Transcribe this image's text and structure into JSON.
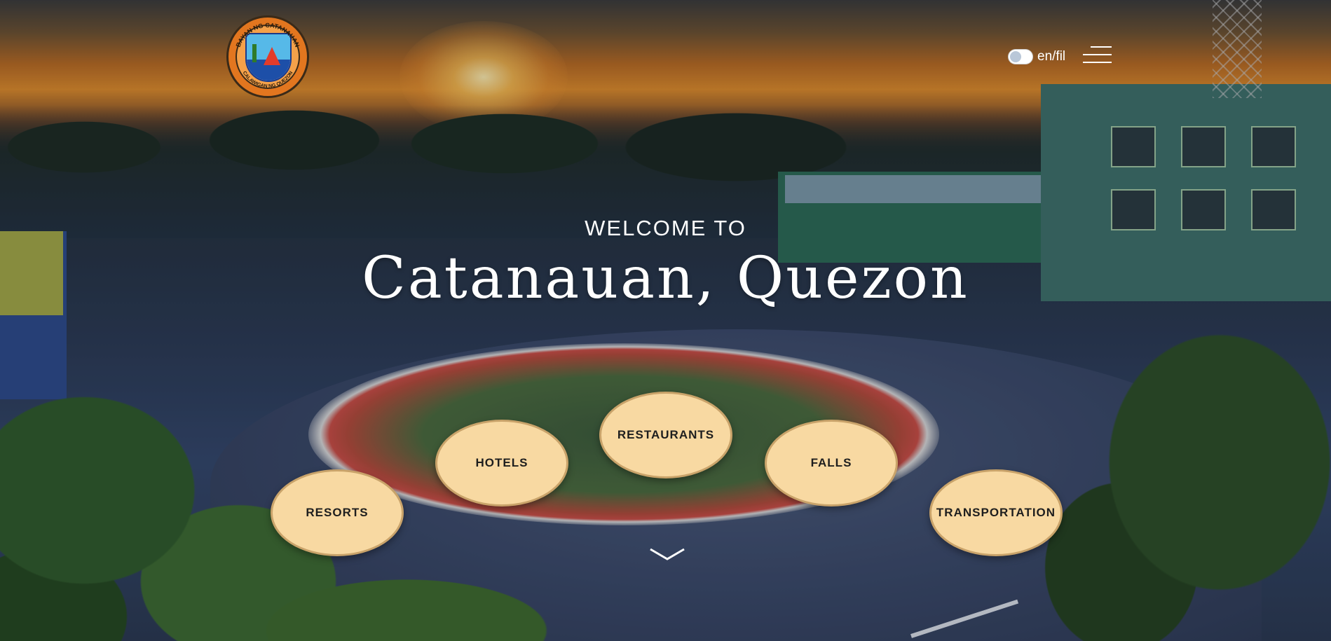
{
  "header": {
    "logo_text_top": "BAYAN NG CATANAUAN",
    "logo_text_bottom": "CALAWIGAN NG QUEZON",
    "language_toggle_label": "en/fil"
  },
  "hero": {
    "welcome": "WELCOME TO",
    "title": "Catanauan, Quezon"
  },
  "categories": [
    {
      "label": "RESORTS"
    },
    {
      "label": "HOTELS"
    },
    {
      "label": "RESTAURANTS"
    },
    {
      "label": "FALLS"
    },
    {
      "label": "TRANSPORTATION"
    }
  ],
  "colors": {
    "bubble_fill": "#f8d9a2",
    "bubble_border": "#c9a36a",
    "text_light": "#ffffff"
  },
  "icons": {
    "menu": "hamburger-menu-icon",
    "scroll": "chevron-down-icon"
  }
}
